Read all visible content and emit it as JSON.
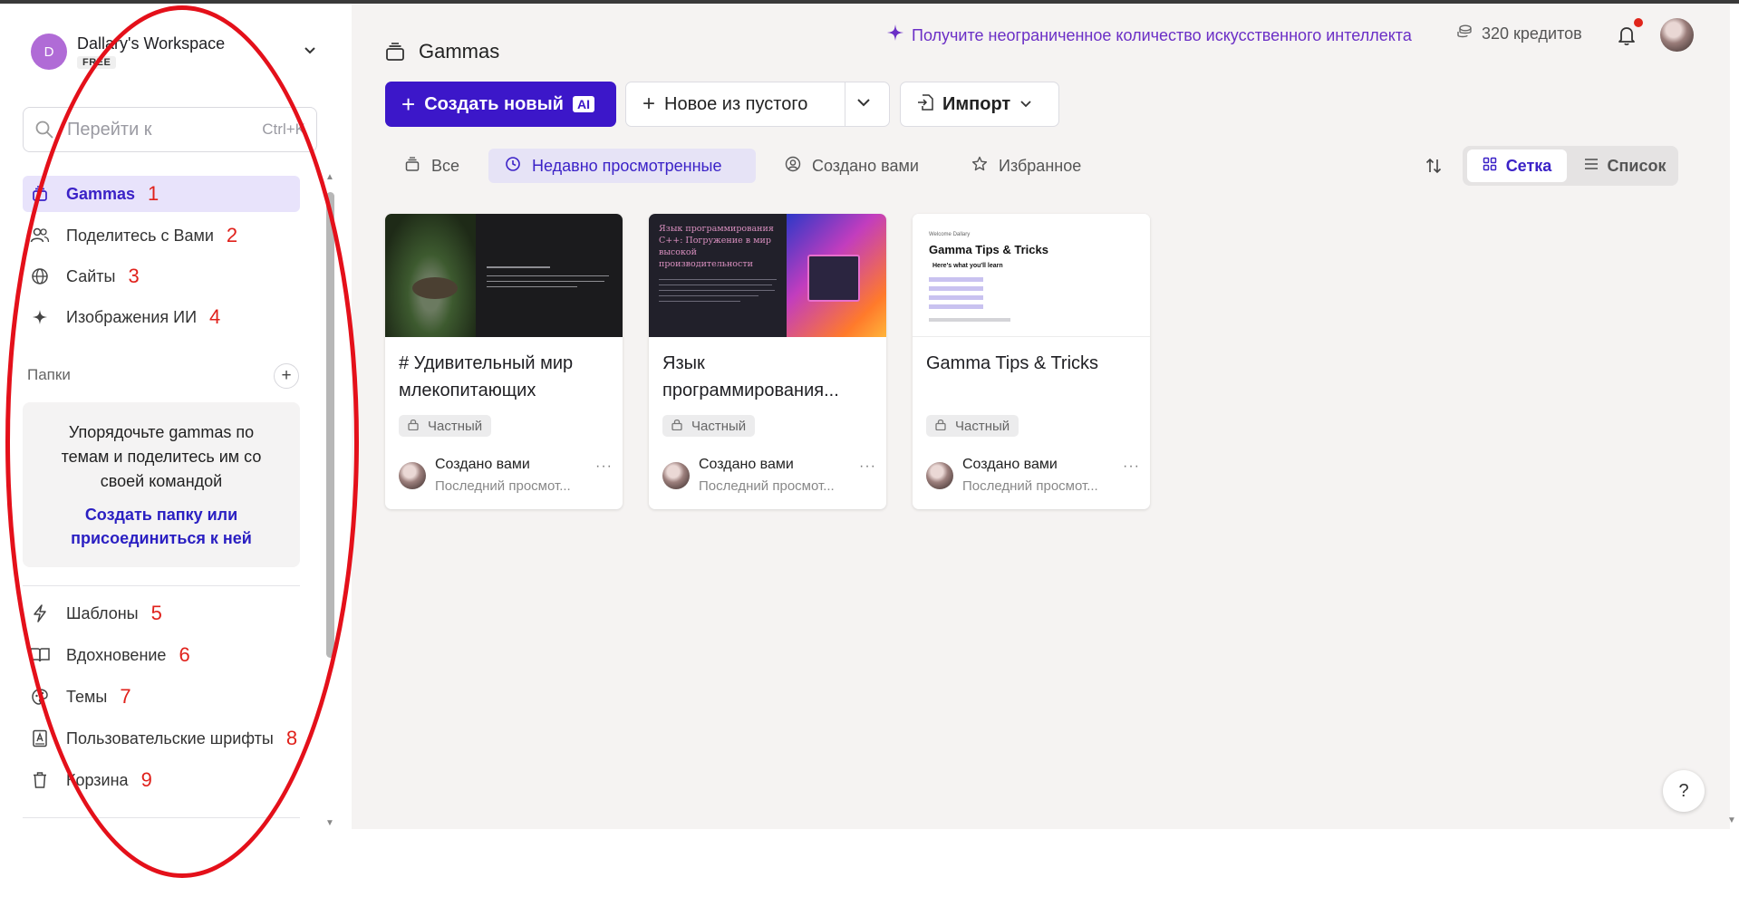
{
  "workspace": {
    "avatar_letter": "D",
    "name": "Dallary's Workspace",
    "plan": "FREE"
  },
  "search": {
    "placeholder": "Перейти к",
    "shortcut": "Ctrl+K"
  },
  "sidebar": {
    "nav": [
      {
        "label": "Gammas",
        "num": "1",
        "icon": "stack-icon",
        "active": true
      },
      {
        "label": "Поделитесь с Вами",
        "num": "2",
        "icon": "users-icon"
      },
      {
        "label": "Сайты",
        "num": "3",
        "icon": "globe-icon"
      },
      {
        "label": "Изображения ИИ",
        "num": "4",
        "icon": "sparkle-icon"
      }
    ],
    "folders_heading": "Папки",
    "folders_add": "+",
    "folders_empty_text": "Упорядочьте gammas по темам и поделитесь им со своей командой",
    "folders_link": "Создать папку или присоединиться к ней",
    "bottom": [
      {
        "label": "Шаблоны",
        "num": "5",
        "icon": "bolt-icon"
      },
      {
        "label": "Вдохновение",
        "num": "6",
        "icon": "book-icon"
      },
      {
        "label": "Темы",
        "num": "7",
        "icon": "palette-icon"
      },
      {
        "label": "Пользовательские шрифты",
        "num": "8",
        "icon": "font-icon"
      },
      {
        "label": "Корзина",
        "num": "9",
        "icon": "trash-icon"
      }
    ]
  },
  "header": {
    "title": "Gammas",
    "promo": "Получите неограниченное количество искусственного интеллекта",
    "credits": "320 кредитов"
  },
  "toolbar": {
    "create_label": "Создать новый",
    "create_badge": "AI",
    "blank_label": "Новое из пустого",
    "import_label": "Импорт"
  },
  "filters": [
    {
      "label": "Все",
      "active": false
    },
    {
      "label": "Недавно просмотренные",
      "active": true
    },
    {
      "label": "Создано вами",
      "active": false
    },
    {
      "label": "Избранное",
      "active": false
    }
  ],
  "view": {
    "grid": "Сетка",
    "list": "Список"
  },
  "cards": [
    {
      "title": "# Удивительный мир млекопитающих",
      "badge": "Частный",
      "by": "Создано вами",
      "seen": "Последний просмот..."
    },
    {
      "title": "Язык программирования...",
      "thumb_title": "Язык программирования C++: Погружение в мир высокой производительности",
      "badge": "Частный",
      "by": "Создано вами",
      "seen": "Последний просмот..."
    },
    {
      "title": "Gamma Tips & Tricks",
      "thumb_welcome": "Welcome Dallary",
      "thumb_title": "Gamma Tips & Tricks",
      "thumb_sub": "Here's what you'll learn",
      "badge": "Частный",
      "by": "Создано вами",
      "seen": "Последний просмот..."
    }
  ],
  "help": "?",
  "colors": {
    "accent": "#3c17c9",
    "promo": "#6b2fc6",
    "annotation_red": "#e0211b"
  }
}
